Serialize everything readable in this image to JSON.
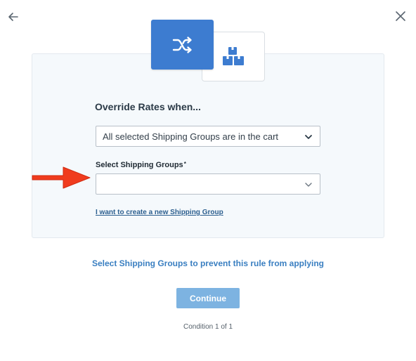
{
  "nav": {
    "back_icon": "arrow-left-icon",
    "close_icon": "close-icon"
  },
  "header_icons": {
    "primary": "shuffle-icon",
    "secondary": "boxes-icon",
    "accent_color": "#3d7cd0"
  },
  "form": {
    "heading": "Override Rates when...",
    "condition_select": {
      "value": "All selected Shipping Groups are in the cart"
    },
    "groups_label": "Select Shipping Groups",
    "required_mark": "*",
    "groups_select": {
      "value": ""
    },
    "create_link": "I want to create a new Shipping Group"
  },
  "annotation": {
    "pointer_icon": "red-arrow-icon",
    "color": "#f03c1e"
  },
  "hint": "Select Shipping Groups to prevent this rule from applying",
  "continue_label": "Continue",
  "condition_status": "Condition 1 of 1"
}
